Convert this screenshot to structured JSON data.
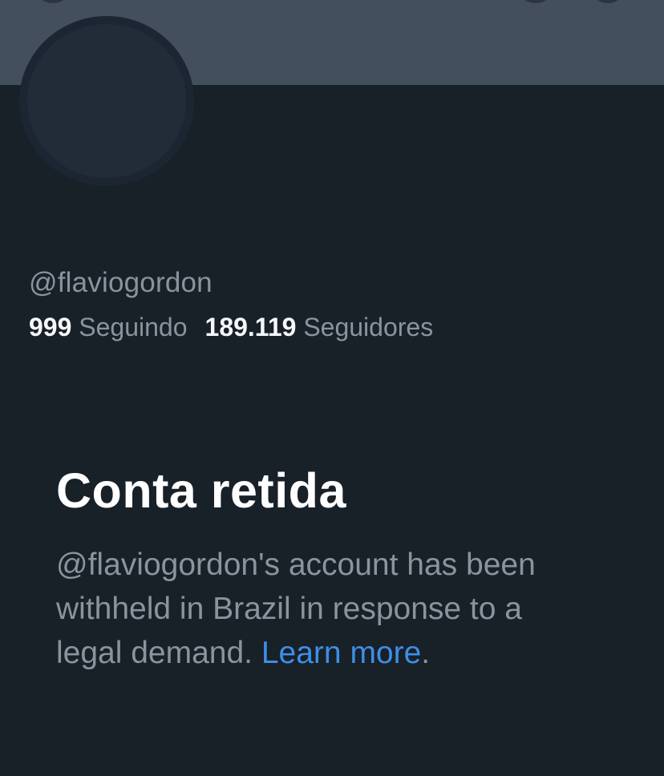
{
  "profile": {
    "handle": "@flaviogordon",
    "following_count": "999",
    "following_label": "Seguindo",
    "followers_count": "189.119",
    "followers_label": "Seguidores"
  },
  "withheld_notice": {
    "title": "Conta retida",
    "body_text": "@flaviogordon's account has been withheld in Brazil in response to a legal demand.",
    "link_text": "Learn more",
    "trailing_punctuation": "."
  },
  "colors": {
    "background": "#182028",
    "banner": "#434f5d",
    "avatar": "#212c38",
    "primary_text": "#ffffff",
    "secondary_text": "#8a949e",
    "link": "#3e8ee6"
  }
}
